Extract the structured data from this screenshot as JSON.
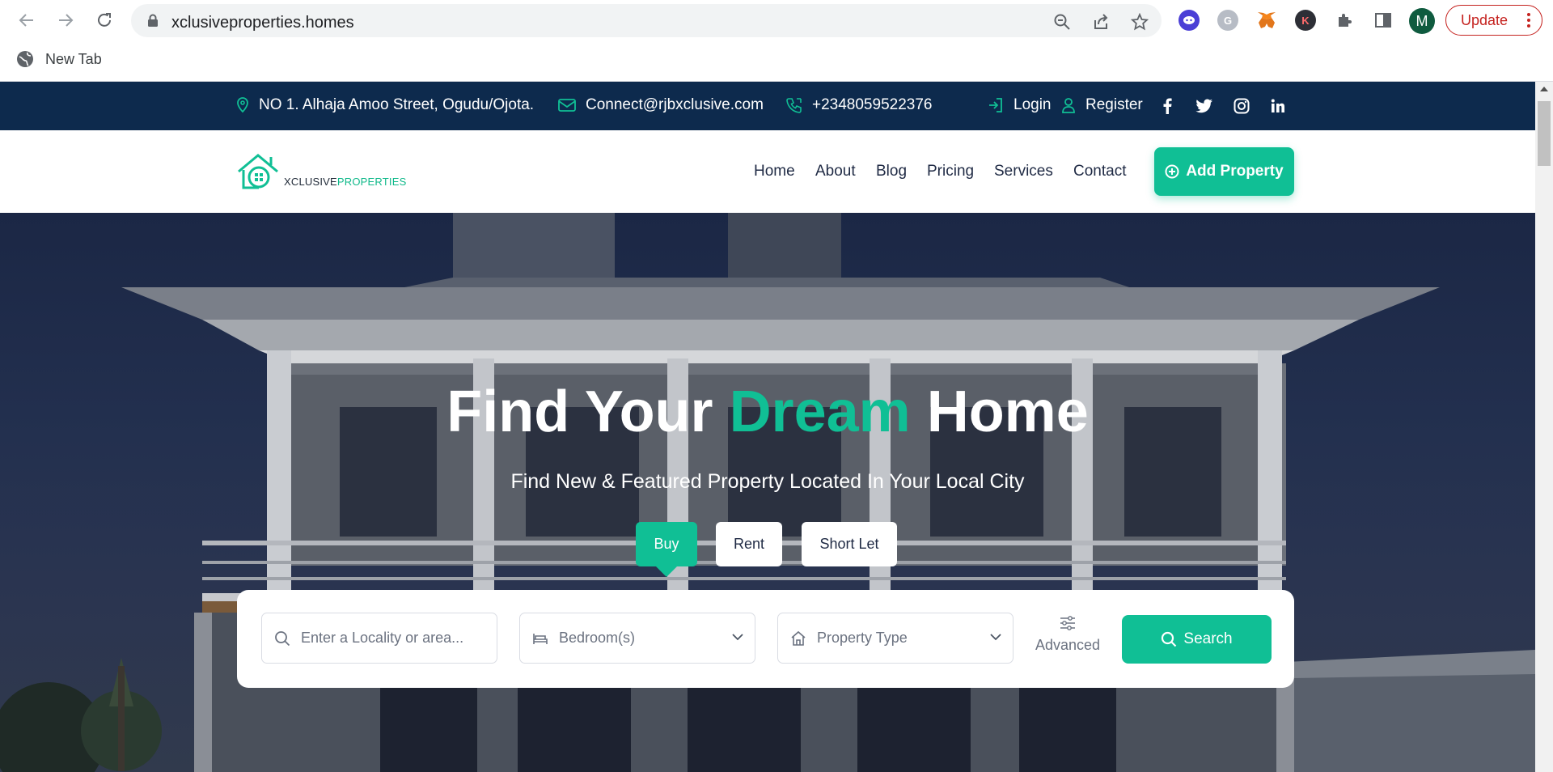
{
  "browser": {
    "url": "xclusiveproperties.homes",
    "update_label": "Update",
    "profile_initial": "M",
    "bookmark_label": "New Tab",
    "extensions": [
      "chat-extension-icon",
      "grammarly-icon",
      "metamask-icon",
      "k-extension-icon"
    ]
  },
  "topbar": {
    "address": "NO 1. Alhaja Amoo Street, Ogudu/Ojota.",
    "email": "Connect@rjbxclusive.com",
    "phone": "+2348059522376",
    "login": "Login",
    "register": "Register"
  },
  "brand": {
    "logo_main": "XCLUSIVE",
    "logo_accent": "PROPERTIES",
    "accent_color": "#10bf95",
    "topbar_color": "#0d2a4d"
  },
  "nav": {
    "items": [
      {
        "label": "Home"
      },
      {
        "label": "About"
      },
      {
        "label": "Blog"
      },
      {
        "label": "Pricing"
      },
      {
        "label": "Services"
      },
      {
        "label": "Contact"
      }
    ],
    "cta": "Add Property"
  },
  "hero": {
    "title_part1": "Find Your",
    "title_highlight": "Dream",
    "title_part2": "Home",
    "subtitle": "Find New & Featured Property Located In Your Local City",
    "tabs": [
      {
        "label": "Buy",
        "active": true
      },
      {
        "label": "Rent",
        "active": false
      },
      {
        "label": "Short Let",
        "active": false
      }
    ]
  },
  "search": {
    "locality_placeholder": "Enter a Locality or area...",
    "bedroom_placeholder": "Bedroom(s)",
    "type_placeholder": "Property Type",
    "advanced_label": "Advanced",
    "button_label": "Search"
  }
}
